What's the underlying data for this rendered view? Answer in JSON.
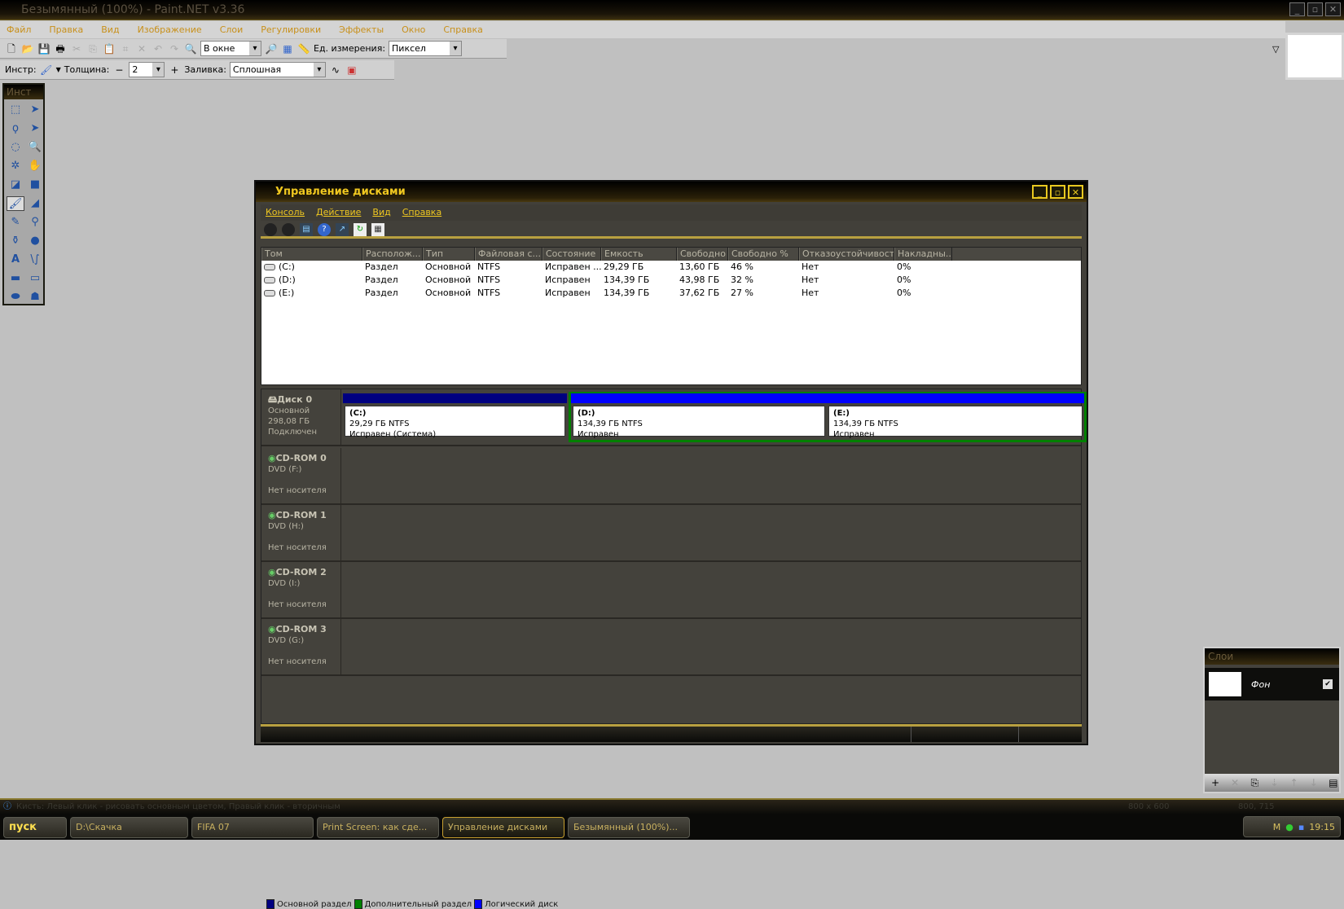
{
  "app": {
    "title": "Безымянный (100%) - Paint.NET v3.36",
    "menu": [
      "Файл",
      "Правка",
      "Вид",
      "Изображение",
      "Слои",
      "Регулировки",
      "Эффекты",
      "Окно",
      "Справка"
    ],
    "zoom_value": "В окне",
    "units_label": "Ед. измерения:",
    "units_value": "Пиксел",
    "tool_label": "Инстр:",
    "width_label": "Толщина:",
    "width_value": "2",
    "fill_label": "Заливка:",
    "fill_value": "Сплошная",
    "tools_title": "Инст",
    "status_text": "Кисть: Левый клик - рисовать основным цветом, Правый клик - вторичным",
    "image_size": "800 x 600",
    "cursor_pos": "800, 715"
  },
  "layers": {
    "title": "Слои",
    "items": [
      {
        "name": "Фон",
        "visible": true
      }
    ]
  },
  "diskmgmt": {
    "title": "Управление дисками",
    "menu": [
      "Консоль",
      "Действие",
      "Вид",
      "Справка"
    ],
    "columns": [
      "Том",
      "Располож...",
      "Тип",
      "Файловая с...",
      "Состояние",
      "Емкость",
      "Свободно",
      "Свободно %",
      "Отказоустойчивость",
      "Накладны..."
    ],
    "rows": [
      [
        "(C:)",
        "Раздел",
        "Основной",
        "NTFS",
        "Исправен ...",
        "29,29 ГБ",
        "13,60 ГБ",
        "46 %",
        "Нет",
        "0%"
      ],
      [
        "(D:)",
        "Раздел",
        "Основной",
        "NTFS",
        "Исправен",
        "134,39 ГБ",
        "43,98 ГБ",
        "32 %",
        "Нет",
        "0%"
      ],
      [
        "(E:)",
        "Раздел",
        "Основной",
        "NTFS",
        "Исправен",
        "134,39 ГБ",
        "37,62 ГБ",
        "27 %",
        "Нет",
        "0%"
      ]
    ],
    "disk0": {
      "name": "Диск 0",
      "type": "Основной",
      "size": "298,08 ГБ",
      "state": "Подключен",
      "partitions": [
        {
          "name": "(C:)",
          "size": "29,29 ГБ NTFS",
          "status": "Исправен (Система)"
        },
        {
          "name": "(D:)",
          "size": "134,39 ГБ NTFS",
          "status": "Исправен"
        },
        {
          "name": "(E:)",
          "size": "134,39 ГБ NTFS",
          "status": "Исправен"
        }
      ]
    },
    "cdroms": [
      {
        "name": "CD-ROM 0",
        "drive": "DVD (F:)",
        "media": "Нет носителя"
      },
      {
        "name": "CD-ROM 1",
        "drive": "DVD (H:)",
        "media": "Нет носителя"
      },
      {
        "name": "CD-ROM 2",
        "drive": "DVD (I:)",
        "media": "Нет носителя"
      },
      {
        "name": "CD-ROM 3",
        "drive": "DVD (G:)",
        "media": "Нет носителя"
      }
    ],
    "legend": [
      {
        "label": "Основной раздел",
        "color": "#000080"
      },
      {
        "label": "Дополнительный раздел",
        "color": "#008000"
      },
      {
        "label": "Логический диск",
        "color": "#0000ff"
      }
    ]
  },
  "taskbar": {
    "start": "пуск",
    "tasks": [
      "D:\\Скачка",
      "FIFA 07",
      "Print Screen: как сде...",
      "Управление дисками",
      "Безымянный (100%)..."
    ],
    "clock": "19:15",
    "lang": "M"
  }
}
